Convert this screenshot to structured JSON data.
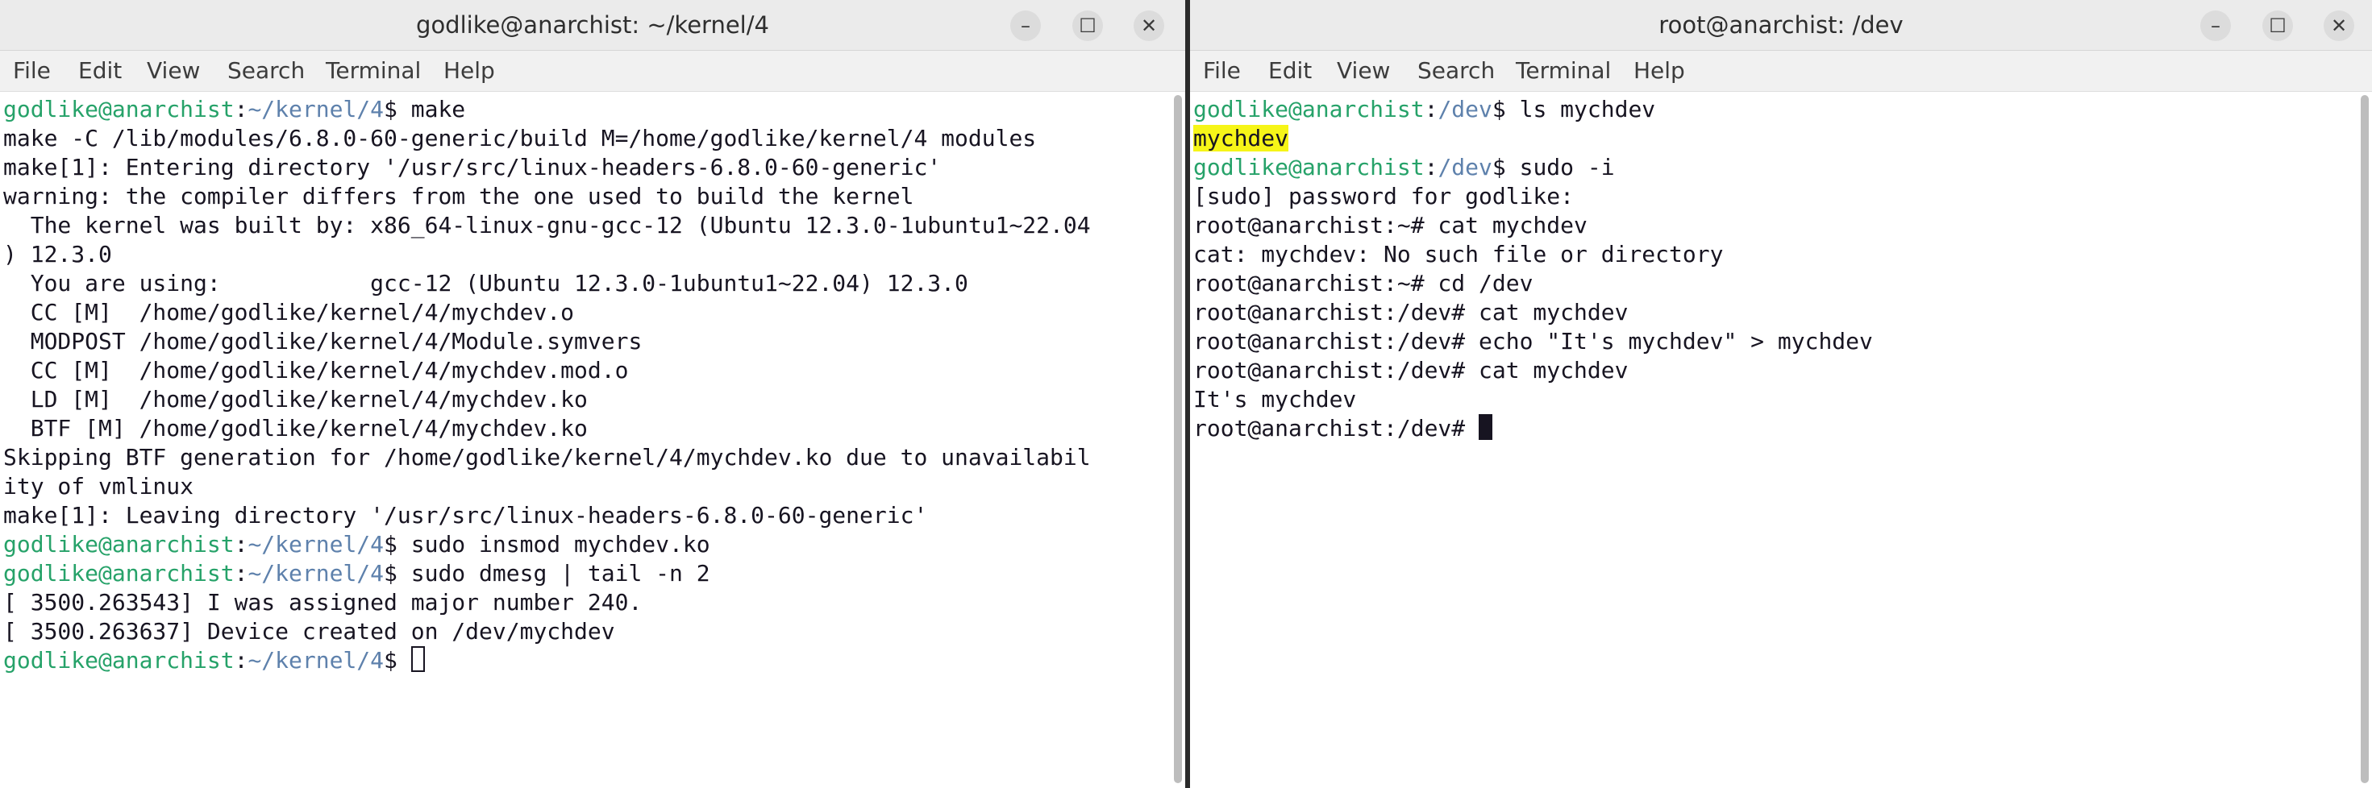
{
  "left_window": {
    "title": "godlike@anarchist: ~/kernel/4",
    "controls": {
      "minimize": "–",
      "maximize": "☐",
      "close": "✕"
    },
    "menu": [
      "File",
      "Edit",
      "View",
      "Search",
      "Terminal",
      "Help"
    ],
    "lines": [
      {
        "user": "godlike@anarchist",
        "colon": ":",
        "path": "~/kernel/4",
        "cmd": "$ make"
      },
      {
        "text": "make -C /lib/modules/6.8.0-60-generic/build M=/home/godlike/kernel/4 modules"
      },
      {
        "text": "make[1]: Entering directory '/usr/src/linux-headers-6.8.0-60-generic'"
      },
      {
        "text": "warning: the compiler differs from the one used to build the kernel"
      },
      {
        "text": "  The kernel was built by: x86_64-linux-gnu-gcc-12 (Ubuntu 12.3.0-1ubuntu1~22.04"
      },
      {
        "text": ") 12.3.0"
      },
      {
        "text": "  You are using:           gcc-12 (Ubuntu 12.3.0-1ubuntu1~22.04) 12.3.0"
      },
      {
        "text": "  CC [M]  /home/godlike/kernel/4/mychdev.o"
      },
      {
        "text": "  MODPOST /home/godlike/kernel/4/Module.symvers"
      },
      {
        "text": "  CC [M]  /home/godlike/kernel/4/mychdev.mod.o"
      },
      {
        "text": "  LD [M]  /home/godlike/kernel/4/mychdev.ko"
      },
      {
        "text": "  BTF [M] /home/godlike/kernel/4/mychdev.ko"
      },
      {
        "text": "Skipping BTF generation for /home/godlike/kernel/4/mychdev.ko due to unavailabil"
      },
      {
        "text": "ity of vmlinux"
      },
      {
        "text": "make[1]: Leaving directory '/usr/src/linux-headers-6.8.0-60-generic'"
      },
      {
        "user": "godlike@anarchist",
        "colon": ":",
        "path": "~/kernel/4",
        "cmd": "$ sudo insmod mychdev.ko"
      },
      {
        "user": "godlike@anarchist",
        "colon": ":",
        "path": "~/kernel/4",
        "cmd": "$ sudo dmesg | tail -n 2"
      },
      {
        "text": "[ 3500.263543] I was assigned major number 240."
      },
      {
        "text": "[ 3500.263637] Device created on /dev/mychdev"
      },
      {
        "user": "godlike@anarchist",
        "colon": ":",
        "path": "~/kernel/4",
        "cmd": "$ ",
        "cursor": "hollow"
      }
    ]
  },
  "right_window": {
    "title": "root@anarchist: /dev",
    "controls": {
      "minimize": "–",
      "maximize": "☐",
      "close": "✕"
    },
    "menu": [
      "File",
      "Edit",
      "View",
      "Search",
      "Terminal",
      "Help"
    ],
    "lines": [
      {
        "user": "godlike@anarchist",
        "colon": ":",
        "path": "/dev",
        "cmd": "$ ls mychdev"
      },
      {
        "highlight": "mychdev"
      },
      {
        "user": "godlike@anarchist",
        "colon": ":",
        "path": "/dev",
        "cmd": "$ sudo -i"
      },
      {
        "text": "[sudo] password for godlike:"
      },
      {
        "text": "root@anarchist:~# cat mychdev"
      },
      {
        "text": "cat: mychdev: No such file or directory"
      },
      {
        "text": "root@anarchist:~# cd /dev"
      },
      {
        "text": "root@anarchist:/dev# cat mychdev"
      },
      {
        "text": "root@anarchist:/dev# echo \"It's mychdev\" > mychdev"
      },
      {
        "text": "root@anarchist:/dev# cat mychdev"
      },
      {
        "text": "It's mychdev"
      },
      {
        "text": "root@anarchist:/dev# ",
        "cursor": "block"
      }
    ]
  },
  "colors": {
    "prompt_user": "#26a269",
    "prompt_path": "#5e81ac",
    "highlight": "#f6f518",
    "text": "#171421"
  }
}
